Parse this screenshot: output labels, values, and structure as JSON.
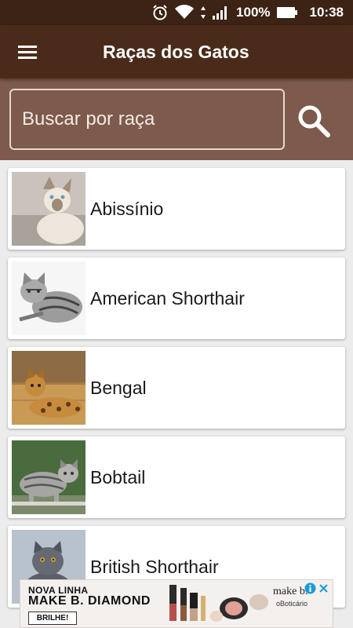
{
  "status_bar": {
    "battery_percent": "100%",
    "time": "10:38",
    "icons": [
      "alarm-icon",
      "wifi-icon",
      "data-transfer-icon",
      "cell-signal-icon",
      "battery-icon"
    ]
  },
  "app_bar": {
    "title": "Raças dos Gatos",
    "menu_icon": "menu-icon"
  },
  "search": {
    "placeholder": "Buscar por raça",
    "value": "",
    "button_icon": "search-icon"
  },
  "breeds": [
    {
      "name": "Abissínio",
      "image": "siamese-cat-photo"
    },
    {
      "name": "American Shorthair",
      "image": "tabby-cat-photo"
    },
    {
      "name": "Bengal",
      "image": "spotted-cat-photo"
    },
    {
      "name": "Bobtail",
      "image": "gray-tabby-cat-photo"
    },
    {
      "name": "British Shorthair",
      "image": "gray-cat-photo"
    }
  ],
  "ad": {
    "line1": "NOVA LINHA",
    "line2": "MAKE B. DIAMOND",
    "cta": "BRILHE!",
    "brand": "make b.",
    "brand_sub": "oBoticário",
    "info_icon": "info-icon",
    "close_icon": "close-icon"
  },
  "colors": {
    "status_bar": "#3c2315",
    "app_bar": "#4a2b1a",
    "search_area": "#7d5a4b",
    "list_background": "#ececec"
  }
}
